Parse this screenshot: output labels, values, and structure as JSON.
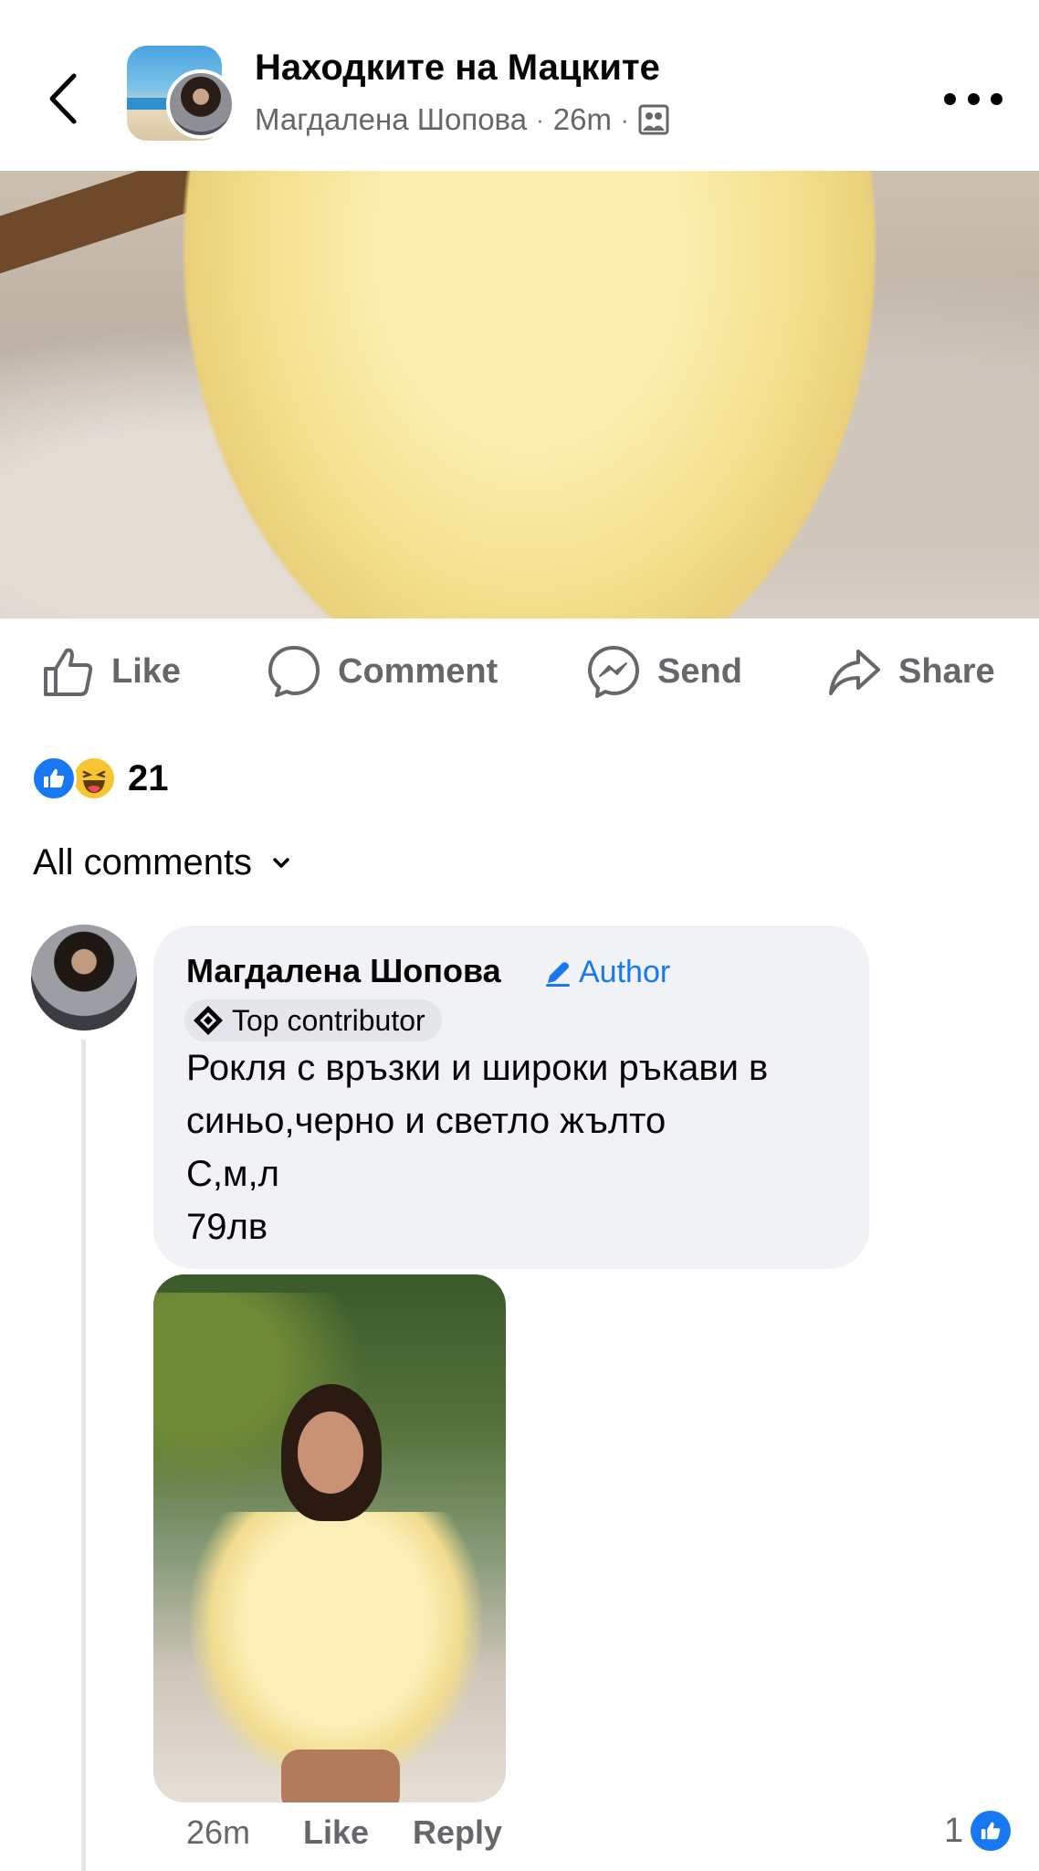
{
  "header": {
    "group_title": "Находките на Мацките",
    "author": "Магдалена Шопова",
    "separator": "·",
    "time": "26m",
    "back_icon": "chevron-left-icon",
    "more_icon": "more-dots-icon",
    "privacy_icon": "group-members-icon"
  },
  "actions": {
    "like": "Like",
    "comment": "Comment",
    "send": "Send",
    "share": "Share"
  },
  "reactions": {
    "count": "21",
    "types": [
      "like",
      "haha"
    ]
  },
  "comments_filter": {
    "label": "All comments"
  },
  "comment": {
    "author": "Магдалена Шопова",
    "author_badge": "Author",
    "contributor_badge": "Top contributor",
    "text_lines": [
      "Рокля с връзки и широки ръкави в",
      "синьо,черно и светло жълто",
      "С,м,л",
      "79лв"
    ],
    "time": "26m",
    "like_label": "Like",
    "reply_label": "Reply",
    "like_count": "1"
  },
  "colors": {
    "accent": "#1877f2",
    "secondary_text": "#65676b",
    "bubble_bg": "#f0f2f5"
  }
}
